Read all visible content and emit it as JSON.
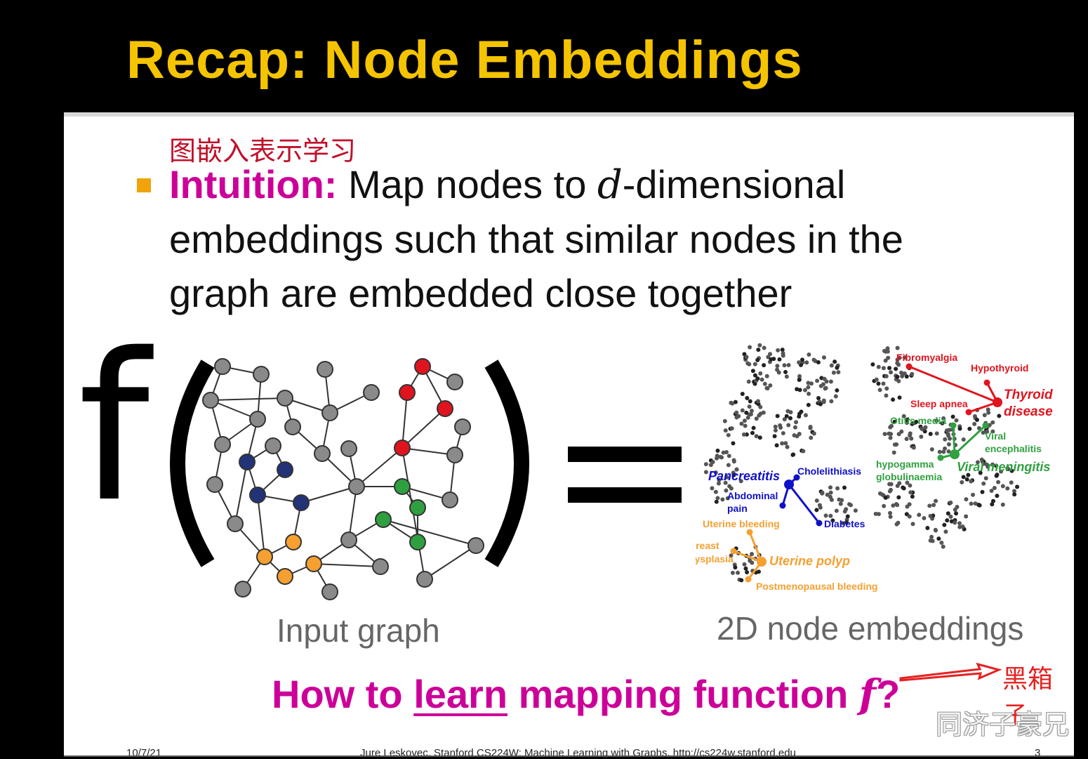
{
  "title": "Recap: Node Embeddings",
  "annotation_note": "图嵌入表示学习",
  "bullet": {
    "lead": "Intuition:",
    "text_before_var": " Map nodes to ",
    "var": "d",
    "text_after_var": "-dimensional embeddings such that similar nodes in the graph are embedded close together"
  },
  "function_symbol": "f",
  "input_caption": "Input graph",
  "output_caption": "2D node embeddings",
  "question": {
    "pre": "How to ",
    "underlined": "learn",
    "post": " mapping function ",
    "var": "f",
    "end": "?"
  },
  "blackbox_note": "黑箱子",
  "watermark": "同济子豪兄",
  "footer": {
    "date": "10/7/21",
    "center": "Jure Leskovec, Stanford CS224W: Machine Learning with Graphs, http://cs224w.stanford.edu",
    "page": "3"
  },
  "colors": {
    "title": "#f5c400",
    "accent": "#cc0099",
    "bullet": "#f0a30a",
    "red": "#e0141e",
    "blue": "#1010c8",
    "green": "#30a040",
    "orange": "#f5a030",
    "navy": "#223377",
    "node_gray": "#808080"
  },
  "embedding_labels": {
    "red": [
      "Fibromyalgia",
      "Hypothyroid",
      "Thyroid",
      "disease",
      "Sleep apnea"
    ],
    "green": [
      "Otitis media",
      "Viral",
      "encephalitis",
      "hypogamma",
      "globulinaemia",
      "Viral meningitis"
    ],
    "blue": [
      "Pancreatitis",
      "Cholelithiasis",
      "Abdominal",
      "pain",
      "Diabetes"
    ],
    "orange": [
      "Uterine bleeding",
      "Breast",
      "dysplasia",
      "Uterine polyp",
      "Postmenopausal bleeding"
    ]
  }
}
